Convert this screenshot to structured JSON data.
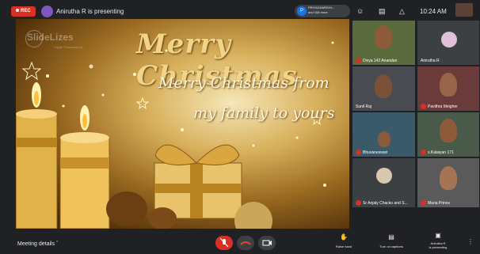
{
  "topbar": {
    "rec_label": "REC",
    "presenter_text": "Anirutha R is presenting",
    "pinned_avatar": "P",
    "pinned_name": "PRIYADHARSHI...",
    "pinned_more": "and 168 more",
    "time": "10:24 AM"
  },
  "slide": {
    "logo_main": "SlideLizes",
    "logo_sub": "Digital Presentations",
    "greeting": "Merry Christmas",
    "message_line1": "Merry Christmas from",
    "message_line2": "my family to yours"
  },
  "participants": [
    {
      "name": "Divya 142 Anandan"
    },
    {
      "name": "Anirutha R"
    },
    {
      "name": "Sunil Raj"
    },
    {
      "name": "Pavithra Meigher"
    },
    {
      "name": "Bhuvaneswari"
    },
    {
      "name": "s.Kalaiyan 171"
    },
    {
      "name": "Sr Anjaly Chacko and S..."
    },
    {
      "name": "Maria Prince"
    }
  ],
  "bottombar": {
    "meeting_details": "Meeting details",
    "raise_hand": "Raise hand",
    "captions": "Turn on captions",
    "presenting_line1": "Anirutha R",
    "presenting_line2": "is presenting"
  },
  "colors": {
    "accent_red": "#d93025",
    "bg": "#202124",
    "tile": "#3c4043"
  }
}
